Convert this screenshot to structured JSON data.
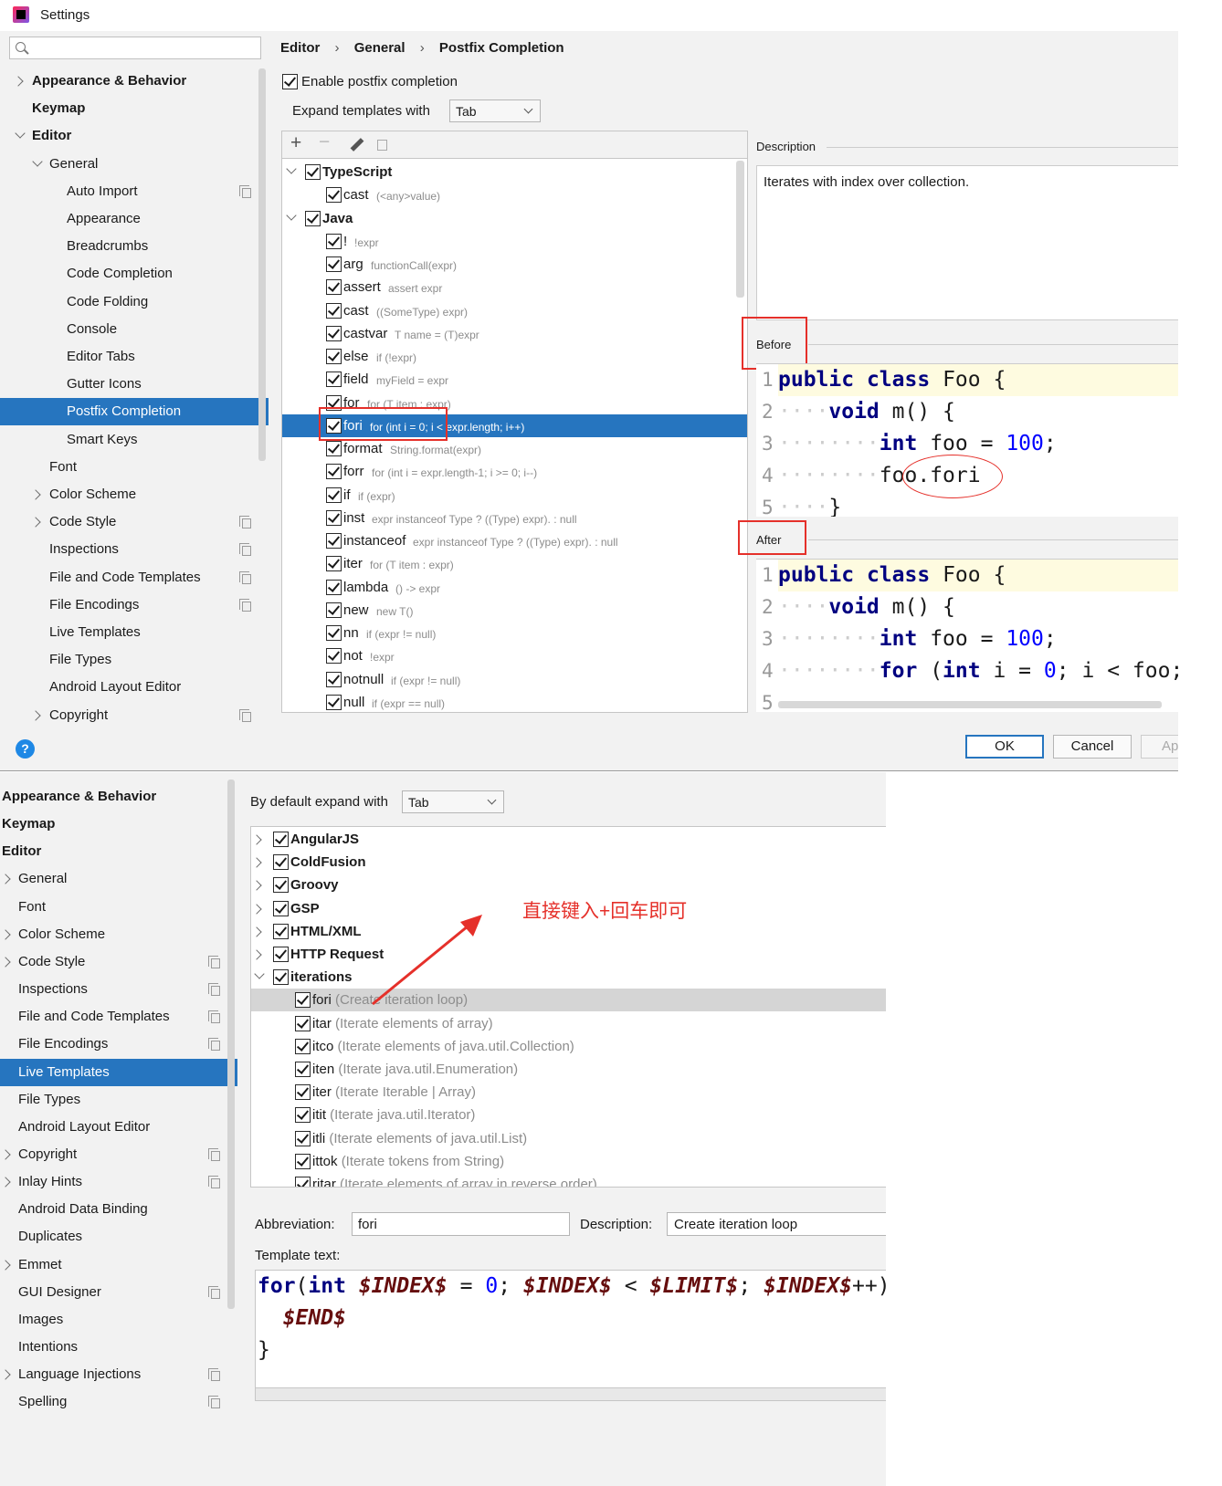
{
  "window": {
    "title": "Settings"
  },
  "top": {
    "sidebar": [
      {
        "label": "Appearance & Behavior",
        "bold": true,
        "arrow": "right",
        "indent": 0
      },
      {
        "label": "Keymap",
        "bold": true,
        "arrow": "",
        "indent": 0
      },
      {
        "label": "Editor",
        "bold": true,
        "arrow": "down",
        "indent": 0
      },
      {
        "label": "General",
        "bold": false,
        "arrow": "down",
        "indent": 1
      },
      {
        "label": "Auto Import",
        "bold": false,
        "arrow": "",
        "indent": 2,
        "copy": true
      },
      {
        "label": "Appearance",
        "bold": false,
        "arrow": "",
        "indent": 2
      },
      {
        "label": "Breadcrumbs",
        "bold": false,
        "arrow": "",
        "indent": 2
      },
      {
        "label": "Code Completion",
        "bold": false,
        "arrow": "",
        "indent": 2
      },
      {
        "label": "Code Folding",
        "bold": false,
        "arrow": "",
        "indent": 2
      },
      {
        "label": "Console",
        "bold": false,
        "arrow": "",
        "indent": 2
      },
      {
        "label": "Editor Tabs",
        "bold": false,
        "arrow": "",
        "indent": 2
      },
      {
        "label": "Gutter Icons",
        "bold": false,
        "arrow": "",
        "indent": 2
      },
      {
        "label": "Postfix Completion",
        "bold": false,
        "arrow": "",
        "indent": 2,
        "selected": true
      },
      {
        "label": "Smart Keys",
        "bold": false,
        "arrow": "",
        "indent": 2
      },
      {
        "label": "Font",
        "bold": false,
        "arrow": "",
        "indent": 1
      },
      {
        "label": "Color Scheme",
        "bold": false,
        "arrow": "right",
        "indent": 1
      },
      {
        "label": "Code Style",
        "bold": false,
        "arrow": "right",
        "indent": 1,
        "copy": true
      },
      {
        "label": "Inspections",
        "bold": false,
        "arrow": "",
        "indent": 1,
        "copy": true
      },
      {
        "label": "File and Code Templates",
        "bold": false,
        "arrow": "",
        "indent": 1,
        "copy": true
      },
      {
        "label": "File Encodings",
        "bold": false,
        "arrow": "",
        "indent": 1,
        "copy": true
      },
      {
        "label": "Live Templates",
        "bold": false,
        "arrow": "",
        "indent": 1
      },
      {
        "label": "File Types",
        "bold": false,
        "arrow": "",
        "indent": 1
      },
      {
        "label": "Android Layout Editor",
        "bold": false,
        "arrow": "",
        "indent": 1
      },
      {
        "label": "Copyright",
        "bold": false,
        "arrow": "right",
        "indent": 1,
        "copy": true
      }
    ],
    "breadcrumb": [
      "Editor",
      "General",
      "Postfix Completion"
    ],
    "enable_label": "Enable postfix completion",
    "expand_label": "Expand templates with",
    "expand_value": "Tab",
    "tree": [
      {
        "group": true,
        "name": "TypeScript",
        "desc": ""
      },
      {
        "name": "cast",
        "desc": "(<any>value)"
      },
      {
        "group": true,
        "name": "Java",
        "desc": ""
      },
      {
        "name": "!",
        "desc": "!expr"
      },
      {
        "name": "arg",
        "desc": "functionCall(expr)"
      },
      {
        "name": "assert",
        "desc": "assert expr"
      },
      {
        "name": "cast",
        "desc": "((SomeType) expr)"
      },
      {
        "name": "castvar",
        "desc": "T name = (T)expr"
      },
      {
        "name": "else",
        "desc": "if (!expr)"
      },
      {
        "name": "field",
        "desc": "myField = expr"
      },
      {
        "name": "for",
        "desc": "for (T item : expr)"
      },
      {
        "name": "fori",
        "desc": "for (int i = 0; i < expr.length; i++)",
        "selected": true
      },
      {
        "name": "format",
        "desc": "String.format(expr)"
      },
      {
        "name": "forr",
        "desc": "for (int i = expr.length-1; i >= 0; i--)"
      },
      {
        "name": "if",
        "desc": "if (expr)"
      },
      {
        "name": "inst",
        "desc": "expr instanceof Type ? ((Type) expr). : null"
      },
      {
        "name": "instanceof",
        "desc": "expr instanceof Type ? ((Type) expr). : null"
      },
      {
        "name": "iter",
        "desc": "for (T item : expr)"
      },
      {
        "name": "lambda",
        "desc": "() -> expr"
      },
      {
        "name": "new",
        "desc": "new T()"
      },
      {
        "name": "nn",
        "desc": "if (expr != null)"
      },
      {
        "name": "not",
        "desc": "!expr"
      },
      {
        "name": "notnull",
        "desc": "if (expr != null)"
      },
      {
        "name": "null",
        "desc": "if (expr == null)"
      }
    ],
    "description_title": "Description",
    "description_text": "Iterates with index over collection.",
    "before_title": "Before",
    "after_title": "After",
    "before_lines": [
      "1",
      "2",
      "3",
      "4",
      "5"
    ],
    "after_lines": [
      "1",
      "2",
      "3",
      "4",
      "5"
    ],
    "code": {
      "public": "public",
      "class": "class",
      "Foo": "Foo",
      "brace": "{",
      "void": "void",
      "m": "m()",
      "int": "int",
      "foo": "foo",
      "eq": "=",
      "hundred": "100",
      "semi": ";",
      "foofori": "foo.fori",
      "close": "}",
      "for": "for",
      "forrest": "(",
      "i": "i",
      "zero": "0",
      "lt": "<",
      "foosemi": "foo;"
    },
    "buttons": {
      "ok": "OK",
      "cancel": "Cancel",
      "apply": "Ap"
    }
  },
  "bottom": {
    "sidebar": [
      {
        "label": "Appearance & Behavior",
        "bold": true,
        "arrow": "",
        "indent": 0
      },
      {
        "label": "Keymap",
        "bold": true,
        "arrow": "",
        "indent": 0
      },
      {
        "label": "Editor",
        "bold": true,
        "arrow": "",
        "indent": 0
      },
      {
        "label": "General",
        "arrow": "right",
        "indent": 1
      },
      {
        "label": "Font",
        "arrow": "",
        "indent": 1
      },
      {
        "label": "Color Scheme",
        "arrow": "right",
        "indent": 1
      },
      {
        "label": "Code Style",
        "arrow": "right",
        "indent": 1,
        "copy": true
      },
      {
        "label": "Inspections",
        "arrow": "",
        "indent": 1,
        "copy": true
      },
      {
        "label": "File and Code Templates",
        "arrow": "",
        "indent": 1,
        "copy": true
      },
      {
        "label": "File Encodings",
        "arrow": "",
        "indent": 1,
        "copy": true
      },
      {
        "label": "Live Templates",
        "arrow": "",
        "indent": 1,
        "selected": true
      },
      {
        "label": "File Types",
        "arrow": "",
        "indent": 1
      },
      {
        "label": "Android Layout Editor",
        "arrow": "",
        "indent": 1
      },
      {
        "label": "Copyright",
        "arrow": "right",
        "indent": 1,
        "copy": true
      },
      {
        "label": "Inlay Hints",
        "arrow": "right",
        "indent": 1,
        "copy": true
      },
      {
        "label": "Android Data Binding",
        "arrow": "",
        "indent": 1
      },
      {
        "label": "Duplicates",
        "arrow": "",
        "indent": 1
      },
      {
        "label": "Emmet",
        "arrow": "right",
        "indent": 1
      },
      {
        "label": "GUI Designer",
        "arrow": "",
        "indent": 1,
        "copy": true
      },
      {
        "label": "Images",
        "arrow": "",
        "indent": 1
      },
      {
        "label": "Intentions",
        "arrow": "",
        "indent": 1
      },
      {
        "label": "Language Injections",
        "arrow": "right",
        "indent": 1,
        "copy": true
      },
      {
        "label": "Spelling",
        "arrow": "",
        "indent": 1,
        "copy": true
      }
    ],
    "expand_label": "By default expand with",
    "expand_value": "Tab",
    "groups": [
      "AngularJS",
      "ColdFusion",
      "Groovy",
      "GSP",
      "HTML/XML",
      "HTTP Request",
      "iterations"
    ],
    "items": [
      {
        "name": "fori",
        "desc": "(Create iteration loop)",
        "selected": true
      },
      {
        "name": "itar",
        "desc": "(Iterate elements of array)"
      },
      {
        "name": "itco",
        "desc": "(Iterate elements of java.util.Collection)"
      },
      {
        "name": "iten",
        "desc": "(Iterate java.util.Enumeration)"
      },
      {
        "name": "iter",
        "desc": "(Iterate Iterable | Array)"
      },
      {
        "name": "itit",
        "desc": "(Iterate java.util.Iterator)"
      },
      {
        "name": "itli",
        "desc": "(Iterate elements of java.util.List)"
      },
      {
        "name": "ittok",
        "desc": "(Iterate tokens from String)"
      },
      {
        "name": "ritar",
        "desc": "(Iterate elements of array in reverse order)"
      }
    ],
    "annotation": "直接键入+回车即可",
    "abbreviation_label": "Abbreviation:",
    "abbreviation_value": "fori",
    "description_label": "Description:",
    "description_value": "Create iteration loop",
    "template_label": "Template text:",
    "template": {
      "for": "for",
      "open": "(",
      "int": "int",
      "index": "$INDEX$",
      "eq": "=",
      "zero": "0",
      "semi": ";",
      "lt": "<",
      "limit": "$LIMIT$",
      "pp": "++)",
      "end": "$END$",
      "close": "}"
    }
  },
  "colors": {
    "selection": "#2675bf",
    "accent_red": "#e5302a",
    "keyword": "#000080"
  }
}
